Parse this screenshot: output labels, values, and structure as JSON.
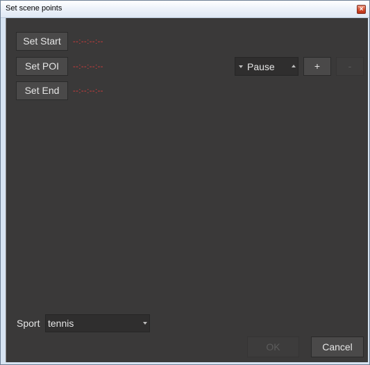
{
  "window": {
    "title": "Set scene points",
    "close_glyph": "×"
  },
  "points": [
    {
      "button_label": "Set Start",
      "time": "--:--:--:--"
    },
    {
      "button_label": "Set POI",
      "time": "--:--:--:--"
    },
    {
      "button_label": "Set End",
      "time": "--:--:--:--"
    }
  ],
  "poi_controls": {
    "mode_value": "Pause",
    "add_label": "+",
    "remove_label": "-"
  },
  "sport": {
    "label": "Sport",
    "value": "tennis"
  },
  "footer": {
    "ok_label": "OK",
    "cancel_label": "Cancel",
    "ok_enabled": false
  },
  "colors": {
    "panel_bg": "#3a3939",
    "button_bg": "#4a4949",
    "timecode": "#e03c3c",
    "text": "#e6e6e6"
  },
  "icons": {
    "close": "close-icon",
    "dropdown": "chevron-down-icon",
    "spin_up": "chevron-up-icon"
  }
}
